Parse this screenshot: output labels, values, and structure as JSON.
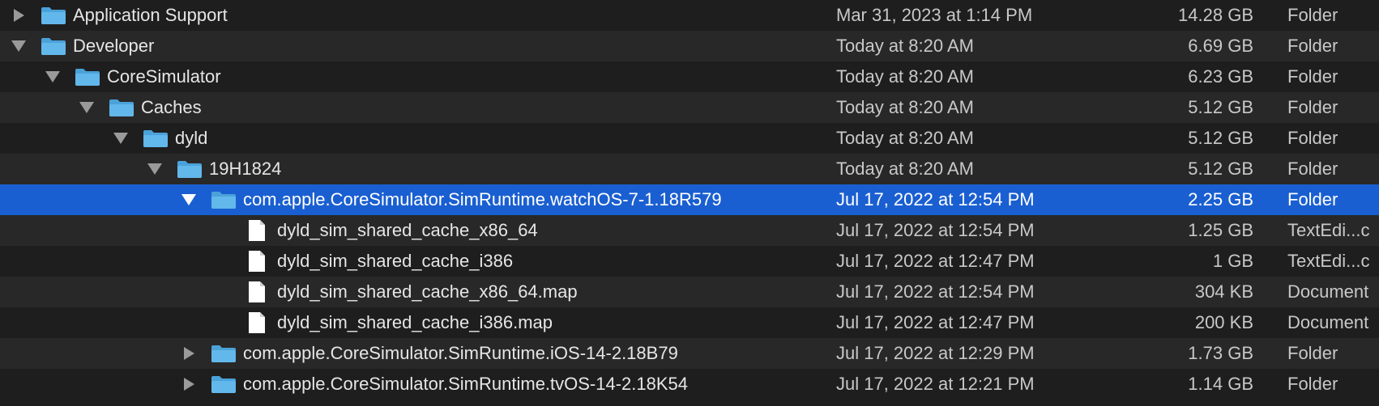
{
  "rows": [
    {
      "name": "Application Support",
      "date": "Mar 31, 2023 at 1:14 PM",
      "size": "14.28 GB",
      "kind": "Folder",
      "disclosure": "collapsed",
      "icon": "folder-icon"
    },
    {
      "name": "Developer",
      "date": "Today at 8:20 AM",
      "size": "6.69 GB",
      "kind": "Folder",
      "disclosure": "expanded",
      "icon": "folder-icon"
    },
    {
      "name": "CoreSimulator",
      "date": "Today at 8:20 AM",
      "size": "6.23 GB",
      "kind": "Folder",
      "disclosure": "expanded",
      "icon": "folder-icon"
    },
    {
      "name": "Caches",
      "date": "Today at 8:20 AM",
      "size": "5.12 GB",
      "kind": "Folder",
      "disclosure": "expanded",
      "icon": "folder-icon"
    },
    {
      "name": "dyld",
      "date": "Today at 8:20 AM",
      "size": "5.12 GB",
      "kind": "Folder",
      "disclosure": "expanded",
      "icon": "folder-icon"
    },
    {
      "name": "19H1824",
      "date": "Today at 8:20 AM",
      "size": "5.12 GB",
      "kind": "Folder",
      "disclosure": "expanded",
      "icon": "folder-icon"
    },
    {
      "name": "com.apple.CoreSimulator.SimRuntime.watchOS-7-1.18R579",
      "date": "Jul 17, 2022 at 12:54 PM",
      "size": "2.25 GB",
      "kind": "Folder",
      "disclosure": "expanded",
      "icon": "folder-icon",
      "selected": true
    },
    {
      "name": "dyld_sim_shared_cache_x86_64",
      "date": "Jul 17, 2022 at 12:54 PM",
      "size": "1.25 GB",
      "kind": "TextEdi...c",
      "icon": "document-icon"
    },
    {
      "name": "dyld_sim_shared_cache_i386",
      "date": "Jul 17, 2022 at 12:47 PM",
      "size": "1 GB",
      "kind": "TextEdi...c",
      "icon": "document-icon"
    },
    {
      "name": "dyld_sim_shared_cache_x86_64.map",
      "date": "Jul 17, 2022 at 12:54 PM",
      "size": "304 KB",
      "kind": "Document",
      "icon": "document-icon"
    },
    {
      "name": "dyld_sim_shared_cache_i386.map",
      "date": "Jul 17, 2022 at 12:47 PM",
      "size": "200 KB",
      "kind": "Document",
      "icon": "document-icon"
    },
    {
      "name": "com.apple.CoreSimulator.SimRuntime.iOS-14-2.18B79",
      "date": "Jul 17, 2022 at 12:29 PM",
      "size": "1.73 GB",
      "kind": "Folder",
      "disclosure": "collapsed",
      "icon": "folder-icon"
    },
    {
      "name": "com.apple.CoreSimulator.SimRuntime.tvOS-14-2.18K54",
      "date": "Jul 17, 2022 at 12:21 PM",
      "size": "1.14 GB",
      "kind": "Folder",
      "disclosure": "collapsed",
      "icon": "folder-icon"
    }
  ],
  "colors": {
    "selection": "#1a5fd1",
    "folder": "#5fb3e4",
    "row_alt": "#282828",
    "row_base": "#1e1e1e"
  }
}
